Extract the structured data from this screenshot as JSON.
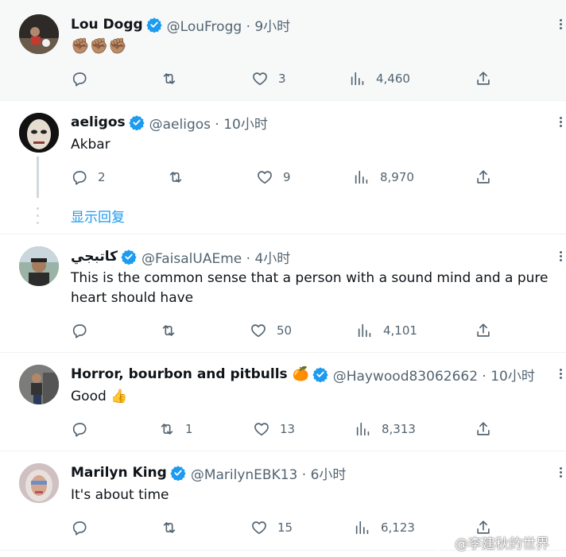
{
  "tweets": [
    {
      "name": "Lou Dogg",
      "handle": "@LouFrogg · 9小时",
      "text": "✊🏽✊🏽✊🏽",
      "replies": "",
      "retweets": "",
      "likes": "3",
      "views": "4,460"
    },
    {
      "name": "aeligos",
      "handle": "@aeligos · 10小时",
      "text": "Akbar",
      "replies": "2",
      "retweets": "",
      "likes": "9",
      "views": "8,970",
      "show_replies": "显示回复"
    },
    {
      "name": "كاتبجي",
      "handle": "@FaisalUAEme · 4小时",
      "text": "This is the common sense that a person with a sound mind and a pure heart should have",
      "replies": "",
      "retweets": "",
      "likes": "50",
      "views": "4,101"
    },
    {
      "name": "Horror, bourbon and pitbulls 🍊",
      "handle": "@Haywood83062662 · 10小时",
      "text": "Good 👍",
      "replies": "",
      "retweets": "1",
      "likes": "13",
      "views": "8,313"
    },
    {
      "name": "Marilyn King",
      "handle": "@MarilynEBK13 · 6小时",
      "text": "It's about time",
      "replies": "",
      "retweets": "",
      "likes": "15",
      "views": "6,123"
    }
  ],
  "watermark": "@李建秋的世界",
  "colors": {
    "verified": "#1d9bf0",
    "link": "#1d9bf0",
    "muted": "#536471"
  }
}
